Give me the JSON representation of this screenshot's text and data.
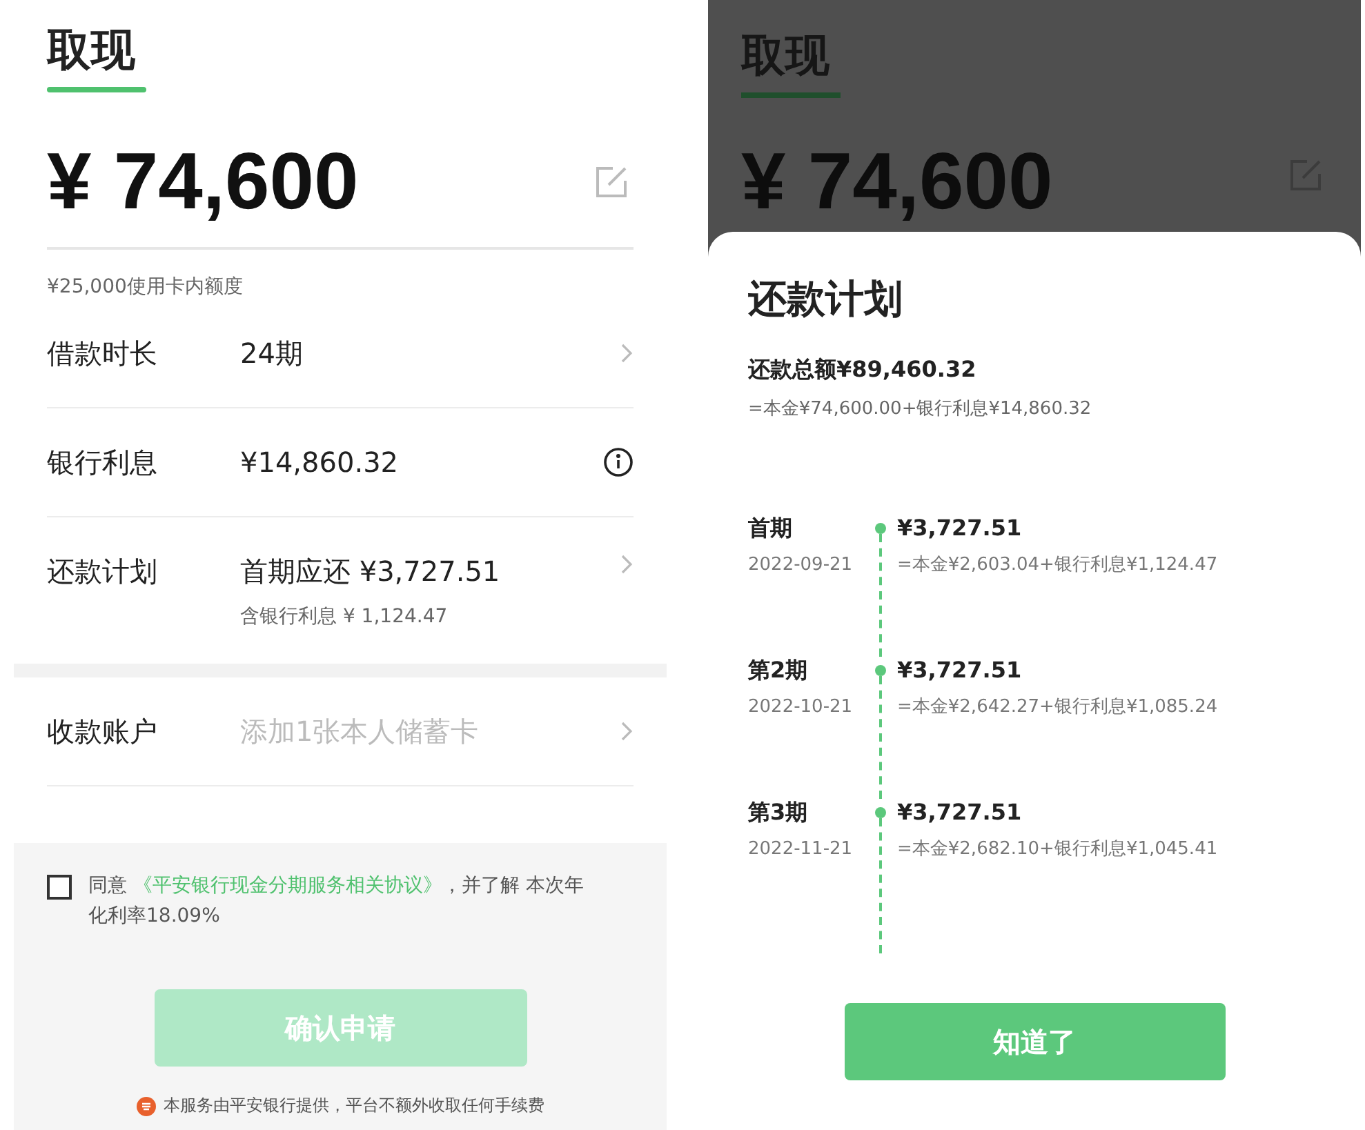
{
  "left": {
    "title": "取现",
    "amount": "¥ 74,600",
    "limit_note": "¥25,000使用卡内额度",
    "rows": [
      {
        "kind": "arrow",
        "label": "借款时长",
        "value": "24期"
      },
      {
        "kind": "info",
        "label": "银行利息",
        "value": "¥14,860.32"
      },
      {
        "kind": "arrow",
        "label": "还款计划",
        "value": "首期应还 ¥3,727.51",
        "sub": "含银行利息 ¥ 1,124.47"
      },
      {
        "kind": "placeholder",
        "label": "收款账户",
        "placeholder": "添加1张本人储蓄卡"
      }
    ],
    "agreement": {
      "checked": false,
      "prefix": "同意 ",
      "link": "《平安银行现金分期服务相关协议》",
      "suffix": "，并了解 本次年化利率18.09%"
    },
    "confirm_button": {
      "label": "确认申请",
      "disabled": true
    },
    "footer_note": "本服务由平安银行提供，平台不额外收取任何手续费"
  },
  "right": {
    "background": {
      "title": "取现",
      "amount": "¥ 74,600"
    },
    "sheet": {
      "title": "还款计划",
      "total": "还款总额¥89,460.32",
      "breakdown": "=本金¥74,600.00+银行利息¥14,860.32",
      "schedule": [
        {
          "period": "首期",
          "date": "2022-09-21",
          "amount": "¥3,727.51",
          "breakdown": "=本金¥2,603.04+银行利息¥1,124.47"
        },
        {
          "period": "第2期",
          "date": "2022-10-21",
          "amount": "¥3,727.51",
          "breakdown": "=本金¥2,642.27+银行利息¥1,085.24"
        },
        {
          "period": "第3期",
          "date": "2022-11-21",
          "amount": "¥3,727.51",
          "breakdown": "=本金¥2,682.10+银行利息¥1,045.41"
        }
      ],
      "button": "知道了"
    }
  }
}
